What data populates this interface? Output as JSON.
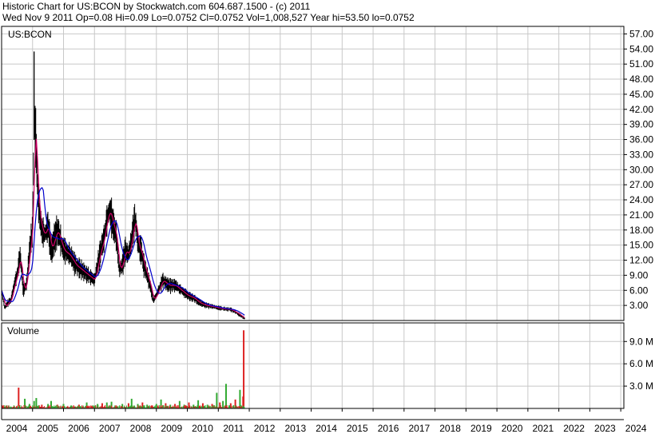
{
  "header": {
    "line1": "Historic Chart for US:BCON by Stockwatch.com 604.687.1500 - (c) 2011",
    "line2": "Wed Nov  9 2011   Op=0.08   Hi=0.09   Lo=0.0752   Cl=0.0752   Vol=1,008,527   Year hi=53.50   lo=0.0752"
  },
  "colors": {
    "price_bar": "#000000",
    "ma_short": "#cc0066",
    "ma_long": "#0000cc",
    "volume_up": "#33aa33",
    "volume_down": "#dd2222",
    "grid": "#c8c8c8",
    "frame": "#000000"
  },
  "chart_data": [
    {
      "type": "line",
      "label": "US:BCON",
      "y_ticks": [
        "57.00",
        "54.00",
        "51.00",
        "48.00",
        "45.00",
        "42.00",
        "39.00",
        "36.00",
        "33.00",
        "30.00",
        "27.00",
        "24.00",
        "21.00",
        "18.00",
        "15.00",
        "12.00",
        "9.00",
        "6.00",
        "3.00"
      ],
      "ylim": [
        0,
        58.5
      ],
      "x_labels": [
        "2004",
        "2005",
        "2006",
        "2007",
        "2008",
        "2009",
        "2010",
        "2011",
        "2012",
        "2013",
        "2014",
        "2015",
        "2016",
        "2017",
        "2018",
        "2019",
        "2020",
        "2021",
        "2022",
        "2023",
        "2024"
      ],
      "xlim": [
        2004.0,
        2024.1
      ],
      "series": [
        {
          "x": [
            2004.0,
            2004.1,
            2004.2,
            2004.3,
            2004.4,
            2004.5,
            2004.6,
            2004.7,
            2004.8,
            2004.9,
            2005.0,
            2005.05,
            2005.1,
            2005.15,
            2005.2,
            2005.3,
            2005.4,
            2005.5,
            2005.6,
            2005.7,
            2005.8,
            2005.9,
            2006.0,
            2006.2,
            2006.4,
            2006.6,
            2006.8,
            2007.0,
            2007.2,
            2007.3,
            2007.4,
            2007.5,
            2007.6,
            2007.7,
            2007.8,
            2007.9,
            2008.0,
            2008.1,
            2008.2,
            2008.3,
            2008.35,
            2008.4,
            2008.5,
            2008.6,
            2008.7,
            2008.8,
            2008.9,
            2009.0,
            2009.2,
            2009.4,
            2009.6,
            2009.8,
            2010.0,
            2010.2,
            2010.4,
            2010.6,
            2010.8,
            2011.0,
            2011.2,
            2011.4,
            2011.6,
            2011.85
          ],
          "values": [
            6,
            2.5,
            3.5,
            4,
            7,
            9,
            13,
            6,
            7,
            14,
            18,
            40,
            36,
            28,
            22,
            18,
            17,
            19,
            14,
            16,
            18,
            16,
            14,
            13,
            11,
            10,
            9,
            8,
            14,
            16,
            20,
            22,
            19,
            17,
            10,
            11,
            14,
            13,
            16,
            20,
            19,
            15,
            14,
            11,
            9,
            7,
            4,
            5,
            8,
            7,
            7,
            6,
            5,
            4.5,
            3.5,
            3,
            2.8,
            2.5,
            2.3,
            2.2,
            1.5,
            0.4
          ]
        }
      ],
      "volume": {
        "label": "Volume",
        "y_ticks": [
          "9.0 M",
          "6.0 M",
          "3.0 M"
        ],
        "ylim": [
          0,
          11.5
        ],
        "bars": [
          {
            "x": 2004.55,
            "value": 2.8,
            "dir": "down"
          },
          {
            "x": 2004.75,
            "value": 1.3,
            "dir": "up"
          },
          {
            "x": 2004.9,
            "value": 0.6,
            "dir": "up"
          },
          {
            "x": 2005.05,
            "value": 1.0,
            "dir": "up"
          },
          {
            "x": 2005.12,
            "value": 1.4,
            "dir": "up"
          },
          {
            "x": 2005.3,
            "value": 0.5,
            "dir": "down"
          },
          {
            "x": 2005.5,
            "value": 0.6,
            "dir": "up"
          },
          {
            "x": 2005.6,
            "value": 1.0,
            "dir": "up"
          },
          {
            "x": 2005.8,
            "value": 0.5,
            "dir": "down"
          },
          {
            "x": 2006.0,
            "value": 0.6,
            "dir": "up"
          },
          {
            "x": 2006.25,
            "value": 0.4,
            "dir": "up"
          },
          {
            "x": 2006.5,
            "value": 0.5,
            "dir": "down"
          },
          {
            "x": 2006.75,
            "value": 0.8,
            "dir": "up"
          },
          {
            "x": 2006.95,
            "value": 0.4,
            "dir": "up"
          },
          {
            "x": 2007.1,
            "value": 0.6,
            "dir": "up"
          },
          {
            "x": 2007.25,
            "value": 0.7,
            "dir": "down"
          },
          {
            "x": 2007.4,
            "value": 0.8,
            "dir": "up"
          },
          {
            "x": 2007.55,
            "value": 0.9,
            "dir": "up"
          },
          {
            "x": 2007.7,
            "value": 0.4,
            "dir": "down"
          },
          {
            "x": 2007.9,
            "value": 0.6,
            "dir": "up"
          },
          {
            "x": 2008.1,
            "value": 0.7,
            "dir": "down"
          },
          {
            "x": 2008.2,
            "value": 1.3,
            "dir": "up"
          },
          {
            "x": 2008.4,
            "value": 0.6,
            "dir": "up"
          },
          {
            "x": 2008.55,
            "value": 0.8,
            "dir": "down"
          },
          {
            "x": 2008.7,
            "value": 0.5,
            "dir": "up"
          },
          {
            "x": 2008.85,
            "value": 0.4,
            "dir": "down"
          },
          {
            "x": 2009.0,
            "value": 0.6,
            "dir": "up"
          },
          {
            "x": 2009.15,
            "value": 1.2,
            "dir": "up"
          },
          {
            "x": 2009.3,
            "value": 0.7,
            "dir": "down"
          },
          {
            "x": 2009.45,
            "value": 0.5,
            "dir": "up"
          },
          {
            "x": 2009.6,
            "value": 0.6,
            "dir": "down"
          },
          {
            "x": 2009.75,
            "value": 1.0,
            "dir": "up"
          },
          {
            "x": 2009.9,
            "value": 0.5,
            "dir": "up"
          },
          {
            "x": 2010.05,
            "value": 0.8,
            "dir": "down"
          },
          {
            "x": 2010.2,
            "value": 0.5,
            "dir": "up"
          },
          {
            "x": 2010.35,
            "value": 1.1,
            "dir": "up"
          },
          {
            "x": 2010.5,
            "value": 0.7,
            "dir": "down"
          },
          {
            "x": 2010.65,
            "value": 0.5,
            "dir": "up"
          },
          {
            "x": 2010.8,
            "value": 0.6,
            "dir": "down"
          },
          {
            "x": 2010.95,
            "value": 2.1,
            "dir": "up"
          },
          {
            "x": 2011.05,
            "value": 0.8,
            "dir": "down"
          },
          {
            "x": 2011.15,
            "value": 1.0,
            "dir": "up"
          },
          {
            "x": 2011.25,
            "value": 3.3,
            "dir": "up"
          },
          {
            "x": 2011.4,
            "value": 0.7,
            "dir": "down"
          },
          {
            "x": 2011.55,
            "value": 1.2,
            "dir": "down"
          },
          {
            "x": 2011.7,
            "value": 2.5,
            "dir": "up"
          },
          {
            "x": 2011.8,
            "value": 1.6,
            "dir": "down"
          },
          {
            "x": 2011.82,
            "value": 10.5,
            "dir": "down"
          }
        ]
      }
    }
  ]
}
